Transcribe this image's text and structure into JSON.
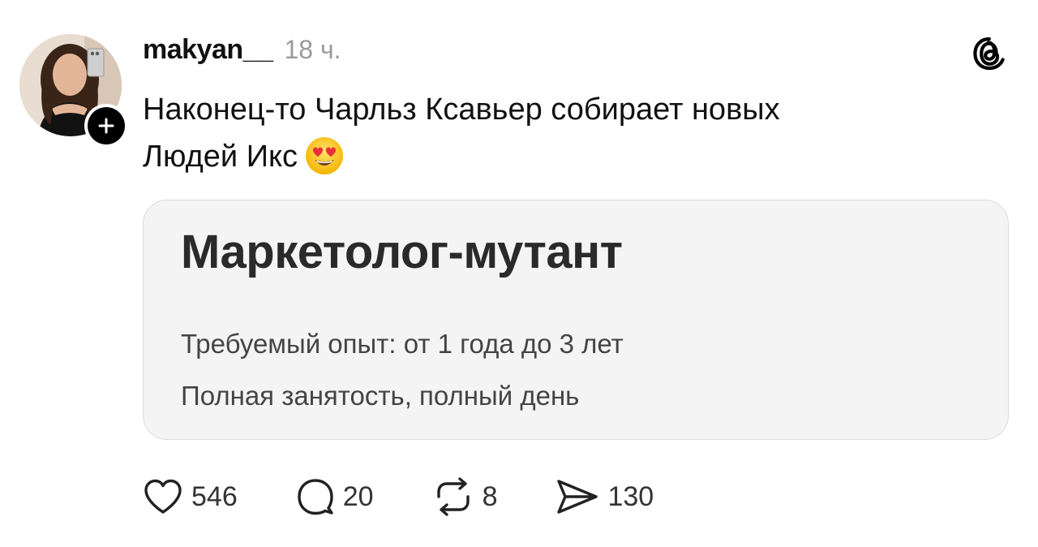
{
  "post": {
    "username": "makyan__",
    "time": "18 ч.",
    "text_line1": "Наконец-то Чарльз Ксавьер собирает новых",
    "text_line2": "Людей Икс",
    "emoji": "heart-eyes-emoji"
  },
  "card": {
    "title": "Маркетолог-мутант",
    "experience": "Требуемый опыт: от 1 года до 3 лет",
    "employment": "Полная занятость, полный день"
  },
  "actions": {
    "likes": "546",
    "comments": "20",
    "reposts": "8",
    "shares": "130"
  },
  "icons": {
    "like": "heart-icon",
    "comment": "comment-bubble-icon",
    "repost": "repost-icon",
    "share": "send-icon",
    "app": "threads-logo-icon",
    "follow": "plus-icon"
  },
  "colors": {
    "text": "#111111",
    "muted": "#9a9a9a",
    "card_bg": "#f4f4f4",
    "card_border": "#dcdcdc"
  }
}
